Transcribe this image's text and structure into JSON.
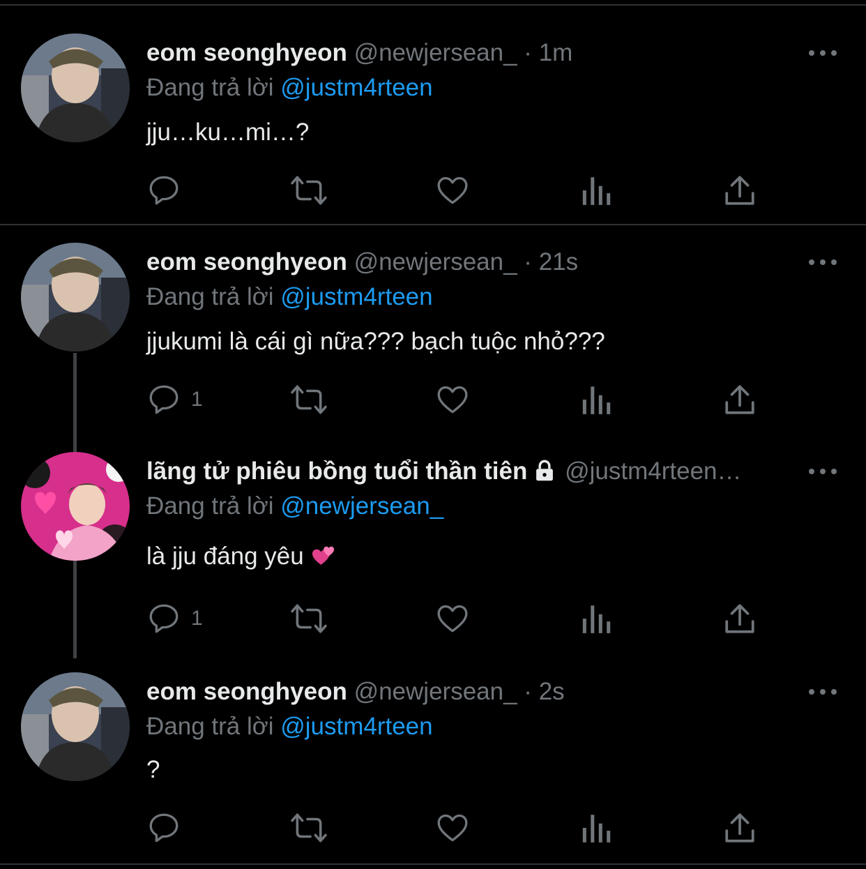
{
  "tweets": [
    {
      "name": "eom seonghyeon",
      "handle": "@newjersean_",
      "dot": "·",
      "time": "1m",
      "reply_prefix": "Đang trả lời",
      "reply_to": "@justm4rteen",
      "text": "jju…ku…mi…?",
      "reply_count": ""
    },
    {
      "name": "eom seonghyeon",
      "handle": "@newjersean_",
      "dot": "·",
      "time": "21s",
      "reply_prefix": "Đang trả lời",
      "reply_to": "@justm4rteen",
      "text": "jjukumi là cái gì nữa??? bạch tuộc nhỏ???",
      "reply_count": "1"
    },
    {
      "name": "lãng tử phiêu bồng tuổi thần tiên",
      "handle": "@justm4rteen…",
      "dot": "",
      "time": "",
      "reply_prefix": "Đang trả lời",
      "reply_to": "@newjersean_",
      "text": "là jju đáng yêu",
      "reply_count": "1"
    },
    {
      "name": "eom seonghyeon",
      "handle": "@newjersean_",
      "dot": "·",
      "time": "2s",
      "reply_prefix": "Đang trả lời",
      "reply_to": "@justm4rteen",
      "text": "?",
      "reply_count": ""
    }
  ],
  "icons": {
    "reply": "reply-icon",
    "retweet": "retweet-icon",
    "like": "heart-icon",
    "analytics": "analytics-icon",
    "share": "share-icon",
    "more": "more-icon",
    "lock": "lock-icon",
    "emoji": "two-hearts-emoji"
  },
  "colors": {
    "background": "#000000",
    "text": "#e7e9ea",
    "muted": "#71767b",
    "link": "#1d9bf0",
    "divider": "#2f3336"
  }
}
